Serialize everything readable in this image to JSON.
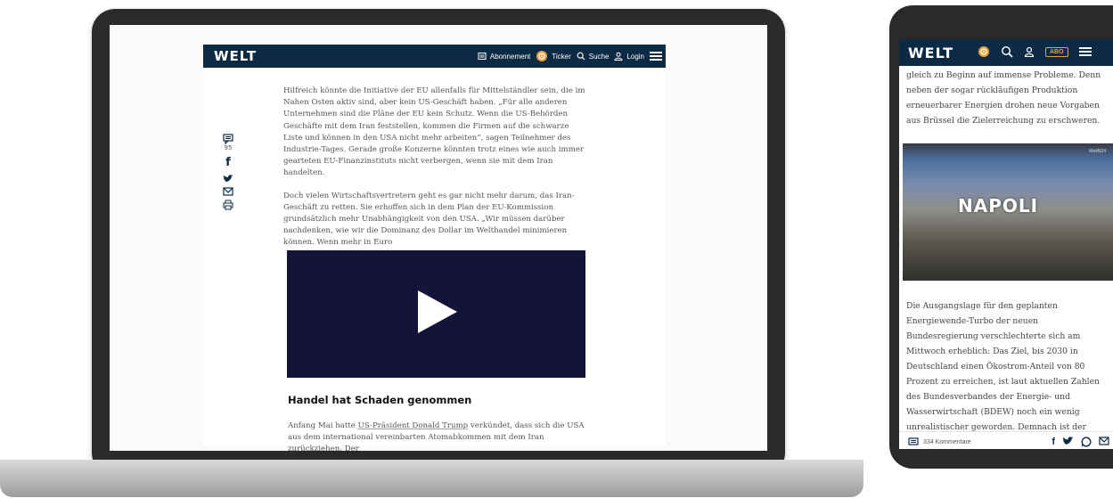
{
  "laptop": {
    "logo": "WELT",
    "nav": [
      {
        "label": "Abonnement",
        "icon": "newspaper-icon"
      },
      {
        "label": "Ticker",
        "icon": "ticker-icon"
      },
      {
        "label": "Suche",
        "icon": "search-icon"
      },
      {
        "label": "Login",
        "icon": "user-icon"
      }
    ],
    "rail": {
      "comment_count": "95",
      "facebook": "f",
      "twitter": "twitter-icon",
      "email": "mail-icon",
      "print": "print-icon"
    },
    "paragraph1": "Hilfreich könnte die Initiative der EU allenfalls für Mittelständler sein, die im Nahen Osten aktiv sind, aber kein US-Geschäft haben. „Für alle anderen Unternehmen sind die Pläne der EU kein Schutz. Wenn die US-Behörden Geschäfte mit dem Iran feststellen, kommen die Firmen auf die schwarze Liste und können in den USA nicht mehr arbeiten“, sagen Teilnehmer des Industrie-Tages. Gerade große Konzerne könnten trotz eines wie auch immer gearteten EU-Finanzinstituts nicht verbergen, wenn sie mit dem Iran handelten.",
    "paragraph2": "Doch vielen Wirtschaftsvertretern geht es gar nicht mehr darum, das Iran-Geschäft zu retten. Sie erhoffen sich in dem Plan der EU-Kommission grundsätzlich mehr Unabhängigkeit von den USA. „Wir müssen darüber nachdenken, wie wir die Dominanz des Dollar im Welthandel minimieren können. Wenn mehr in Euro",
    "heading": "Handel hat Schaden genommen",
    "paragraph3_pre": "Anfang Mai hatte ",
    "paragraph3_link": "US-Präsident Donald Trump",
    "paragraph3_post": " verkündet, dass sich die USA aus dem international vereinbarten Atomabkommen mit dem Iran zurückziehen. Der"
  },
  "phone": {
    "logo": "WELT",
    "abo": "ABO",
    "text_top": "gleich zu Beginn auf immense Probleme. Denn neben der sogar rückläufigen Produktion erneuerbarer Energien drohen neue Vorgaben aus Brüssel die Zielerreichung zu erschweren.",
    "video_title": "NAPOLI",
    "video_brand": "WeltN24",
    "text_bottom": "Die Ausgangslage für den geplanten Energiewende-Turbo der neuen Bundesregierung verschlechterte sich am Mittwoch erheblich: Das Ziel, bis 2030 in Deutschland einen Ökostrom-Anteil von 80 Prozent zu erreichen, ist laut aktuellen Zahlen des Bundesverbandes der Energie- und Wasserwirtschaft (BDEW) noch ein wenig unrealistischer geworden. Demnach ist der Anteil",
    "comments": "334 Kommentare"
  },
  "colors": {
    "brand": "#0c2a44",
    "accent": "#e9a23b",
    "video_bg": "#14133a"
  }
}
